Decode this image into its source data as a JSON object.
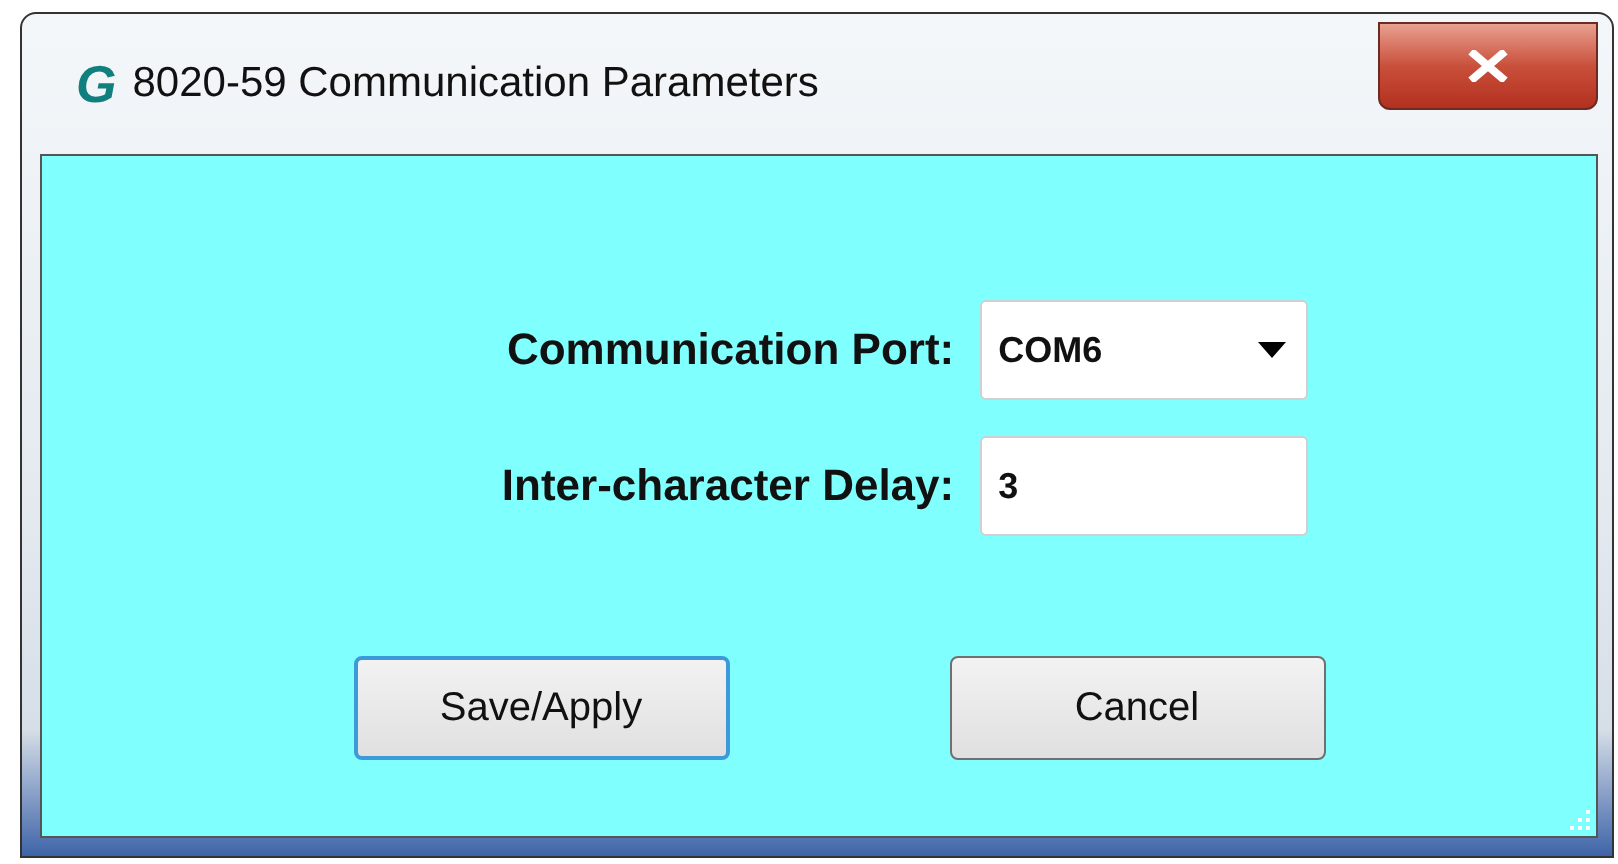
{
  "window": {
    "logo": "G",
    "title": "8020-59 Communication Parameters"
  },
  "fields": [
    {
      "kind": "dropdown",
      "label": "Communication Port:",
      "value": "COM6"
    },
    {
      "kind": "text",
      "label": "Inter-character Delay:",
      "value": "3"
    }
  ],
  "buttons": [
    {
      "label": "Save/Apply",
      "default": true
    },
    {
      "label": "Cancel",
      "default": false
    }
  ]
}
